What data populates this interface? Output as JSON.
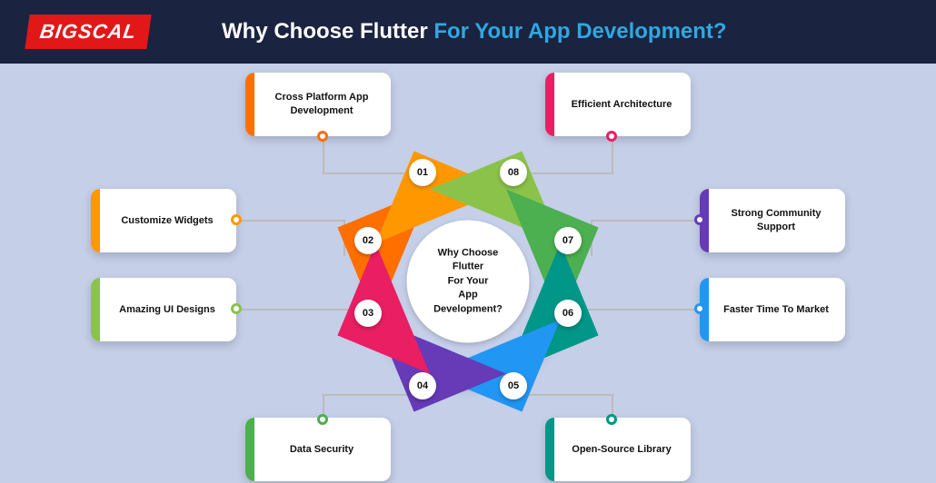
{
  "logo": "BIGSCAL",
  "title_a": "Why Choose Flutter ",
  "title_b": "For Your App Development?",
  "center": "Why Choose\nFlutter\nFor Your\nApp\nDevelopment?",
  "items": [
    {
      "num": "01",
      "label": "Cross Platform App Development",
      "color": "#ff6f00"
    },
    {
      "num": "02",
      "label": "Customize Widgets",
      "color": "#ff9800"
    },
    {
      "num": "03",
      "label": "Amazing UI Designs",
      "color": "#8bc34a"
    },
    {
      "num": "04",
      "label": "Data Security",
      "color": "#4caf50"
    },
    {
      "num": "05",
      "label": "Open-Source Library",
      "color": "#009688"
    },
    {
      "num": "06",
      "label": "Faster Time To Market",
      "color": "#2196f3"
    },
    {
      "num": "07",
      "label": "Strong Community Support",
      "color": "#673ab7"
    },
    {
      "num": "08",
      "label": "Efficient Architecture",
      "color": "#e91e63"
    }
  ]
}
